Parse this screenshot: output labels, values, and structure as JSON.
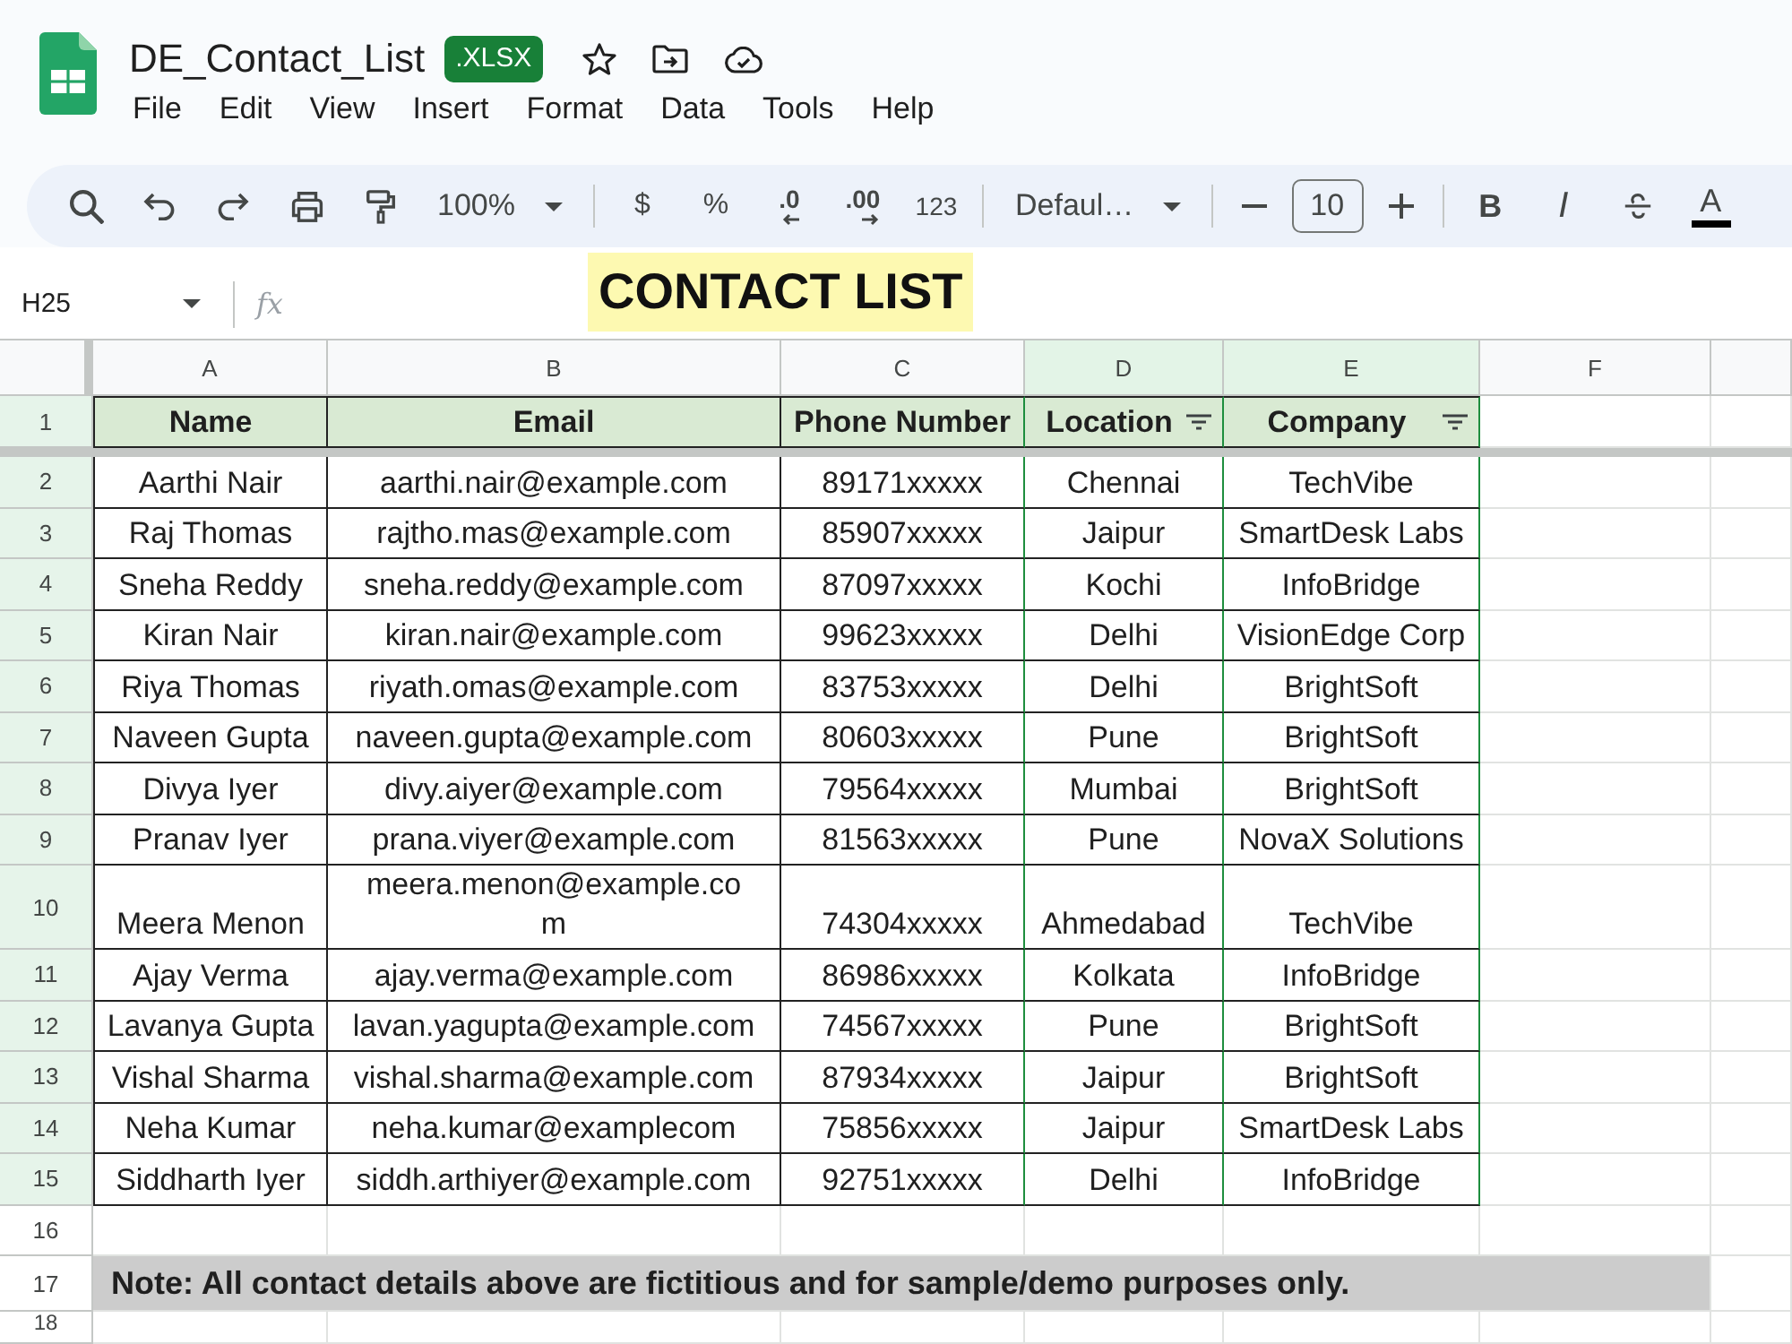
{
  "document": {
    "file_name": "DE_Contact_List",
    "format_badge": ".XLSX"
  },
  "menu": [
    "File",
    "Edit",
    "View",
    "Insert",
    "Format",
    "Data",
    "Tools",
    "Help"
  ],
  "toolbar": {
    "zoom": "100%",
    "currency": "$",
    "percent": "%",
    "decrease_decimals": ".0",
    "increase_decimals": ".00",
    "number_format": "123",
    "font": "Defaul…",
    "font_size": "10",
    "bold": "B",
    "italic": "I",
    "text_color": "A"
  },
  "formula_bar": {
    "cell_reference": "H25",
    "function_label": "fx"
  },
  "banner": "CONTACT LIST",
  "sheet": {
    "columns": [
      {
        "letter": "A",
        "highlighted": false
      },
      {
        "letter": "B",
        "highlighted": false
      },
      {
        "letter": "C",
        "highlighted": false
      },
      {
        "letter": "D",
        "highlighted": true
      },
      {
        "letter": "E",
        "highlighted": true
      },
      {
        "letter": "F",
        "highlighted": false
      }
    ],
    "rows": [
      {
        "number": "1",
        "highlighted": true,
        "kind": "header",
        "cells": [
          {
            "text": "Name",
            "filter": false
          },
          {
            "text": "Email",
            "filter": false
          },
          {
            "text": "Phone Number",
            "filter": false
          },
          {
            "text": "Location",
            "filter": true
          },
          {
            "text": "Company",
            "filter": true
          }
        ]
      },
      {
        "number": "2",
        "highlighted": true,
        "kind": "data",
        "wrapped": false,
        "cells": [
          "Aarthi Nair",
          "aarthi.nair@example.com",
          "89171xxxxx",
          "Chennai",
          "TechVibe"
        ]
      },
      {
        "number": "3",
        "highlighted": true,
        "kind": "data",
        "wrapped": false,
        "cells": [
          "Raj Thomas",
          "rajtho.mas@example.com",
          "85907xxxxx",
          "Jaipur",
          "SmartDesk Labs"
        ]
      },
      {
        "number": "4",
        "highlighted": true,
        "kind": "data",
        "wrapped": false,
        "cells": [
          "Sneha Reddy",
          "sneha.reddy@example.com",
          "87097xxxxx",
          "Kochi",
          "InfoBridge"
        ]
      },
      {
        "number": "5",
        "highlighted": true,
        "kind": "data",
        "wrapped": false,
        "cells": [
          "Kiran Nair",
          "kiran.nair@example.com",
          "99623xxxxx",
          "Delhi",
          "VisionEdge Corp"
        ]
      },
      {
        "number": "6",
        "highlighted": true,
        "kind": "data",
        "wrapped": false,
        "cells": [
          "Riya Thomas",
          "riyath.omas@example.com",
          "83753xxxxx",
          "Delhi",
          "BrightSoft"
        ]
      },
      {
        "number": "7",
        "highlighted": true,
        "kind": "data",
        "wrapped": false,
        "cells": [
          "Naveen Gupta",
          "naveen.gupta@example.com",
          "80603xxxxx",
          "Pune",
          "BrightSoft"
        ]
      },
      {
        "number": "8",
        "highlighted": true,
        "kind": "data",
        "wrapped": false,
        "cells": [
          "Divya Iyer",
          "divy.aiyer@example.com",
          "79564xxxxx",
          "Mumbai",
          "BrightSoft"
        ]
      },
      {
        "number": "9",
        "highlighted": true,
        "kind": "data",
        "wrapped": false,
        "cells": [
          "Pranav Iyer",
          "prana.viyer@example.com",
          "81563xxxxx",
          "Pune",
          "NovaX Solutions"
        ]
      },
      {
        "number": "10",
        "highlighted": true,
        "kind": "data",
        "wrapped": true,
        "cells": [
          "Meera Menon",
          "meera.menon@example.com",
          "74304xxxxx",
          "Ahmedabad",
          "TechVibe"
        ]
      },
      {
        "number": "11",
        "highlighted": true,
        "kind": "data",
        "wrapped": false,
        "cells": [
          "Ajay Verma",
          "ajay.verma@example.com",
          "86986xxxxx",
          "Kolkata",
          "InfoBridge"
        ]
      },
      {
        "number": "12",
        "highlighted": true,
        "kind": "data",
        "wrapped": false,
        "cells": [
          "Lavanya Gupta",
          "lavan.yagupta@example.com",
          "74567xxxxx",
          "Pune",
          "BrightSoft"
        ]
      },
      {
        "number": "13",
        "highlighted": true,
        "kind": "data",
        "wrapped": false,
        "cells": [
          "Vishal Sharma",
          "vishal.sharma@example.com",
          "87934xxxxx",
          "Jaipur",
          "BrightSoft"
        ]
      },
      {
        "number": "14",
        "highlighted": true,
        "kind": "data",
        "wrapped": false,
        "cells": [
          "Neha Kumar",
          "neha.kumar@examplecom",
          "75856xxxxx",
          "Jaipur",
          "SmartDesk Labs"
        ]
      },
      {
        "number": "15",
        "highlighted": true,
        "kind": "data",
        "wrapped": false,
        "cells": [
          "Siddharth Iyer",
          "siddh.arthiyer@example.com",
          "92751xxxxx",
          "Delhi",
          "InfoBridge"
        ]
      },
      {
        "number": "16",
        "highlighted": false,
        "kind": "empty"
      },
      {
        "number": "17",
        "highlighted": false,
        "kind": "note",
        "text": "Note: All contact details above are fictitious and for sample/demo purposes only."
      },
      {
        "number": "18",
        "highlighted": false,
        "kind": "empty"
      }
    ]
  }
}
